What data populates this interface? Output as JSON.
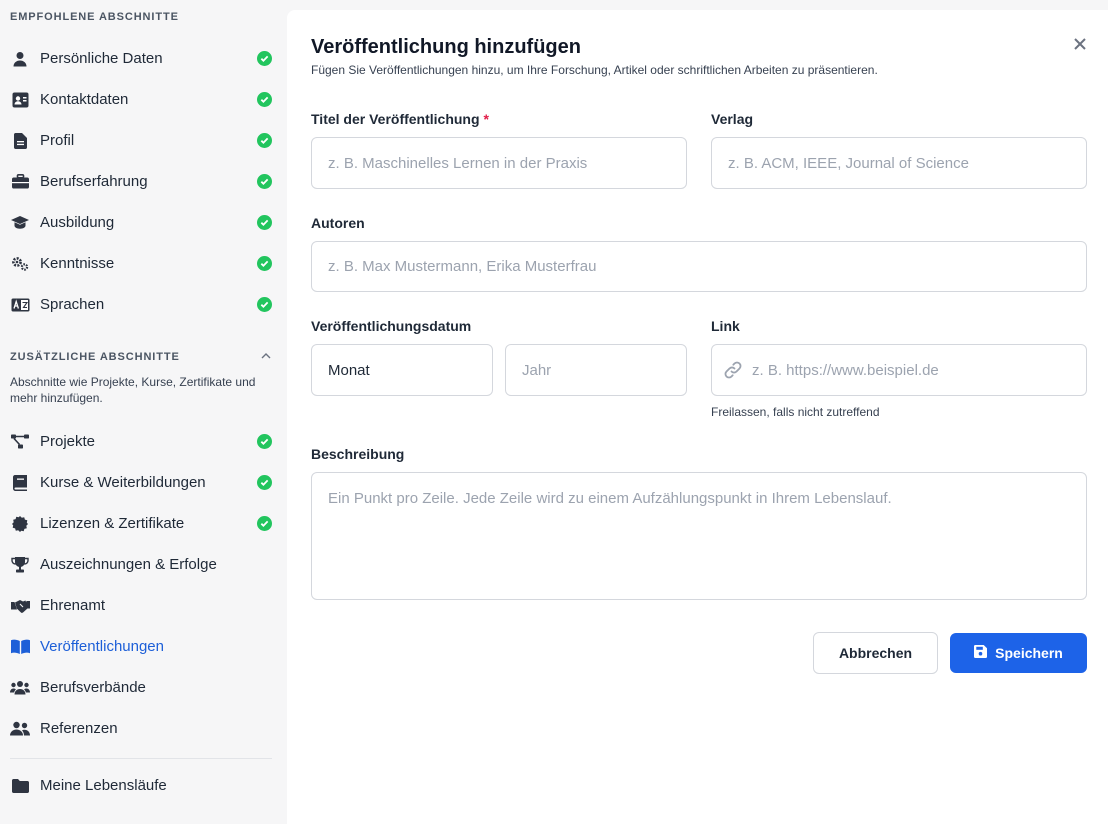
{
  "sidebar": {
    "recommended_title": "EMPFOHLENE ABSCHNITTE",
    "recommended": [
      {
        "label": "Persönliche Daten",
        "icon": "user-icon",
        "done": true
      },
      {
        "label": "Kontaktdaten",
        "icon": "contact-card-icon",
        "done": true
      },
      {
        "label": "Profil",
        "icon": "document-icon",
        "done": true
      },
      {
        "label": "Berufserfahrung",
        "icon": "briefcase-icon",
        "done": true
      },
      {
        "label": "Ausbildung",
        "icon": "graduation-cap-icon",
        "done": true
      },
      {
        "label": "Kenntnisse",
        "icon": "gears-icon",
        "done": true
      },
      {
        "label": "Sprachen",
        "icon": "language-icon",
        "done": true
      }
    ],
    "additional_title": "ZUSÄTZLICHE ABSCHNITTE",
    "additional_note": "Abschnitte wie Projekte, Kurse, Zertifikate und mehr hinzufügen.",
    "additional": [
      {
        "label": "Projekte",
        "icon": "project-diagram-icon",
        "done": true
      },
      {
        "label": "Kurse & Weiterbildungen",
        "icon": "book-icon",
        "done": true
      },
      {
        "label": "Lizenzen & Zertifikate",
        "icon": "certificate-icon",
        "done": true
      },
      {
        "label": "Auszeichnungen & Erfolge",
        "icon": "trophy-icon",
        "done": false
      },
      {
        "label": "Ehrenamt",
        "icon": "handshake-icon",
        "done": false
      },
      {
        "label": "Veröffentlichungen",
        "icon": "open-book-icon",
        "done": false,
        "active": true
      },
      {
        "label": "Berufsverbände",
        "icon": "users-icon",
        "done": false
      },
      {
        "label": "Referenzen",
        "icon": "user-friends-icon",
        "done": false
      }
    ],
    "footer_item": {
      "label": "Meine Lebensläufe",
      "icon": "folder-icon"
    }
  },
  "dialog": {
    "title": "Veröffentlichung hinzufügen",
    "subtitle": "Fügen Sie Veröffentlichungen hinzu, um Ihre Forschung, Artikel oder schriftlichen Arbeiten zu präsentieren.",
    "fields": {
      "title_label": "Titel der Veröffentlichung",
      "required_mark": "*",
      "title_placeholder": "z. B. Maschinelles Lernen in der Praxis",
      "title_value": "",
      "publisher_label": "Verlag",
      "publisher_placeholder": "z. B. ACM, IEEE, Journal of Science",
      "publisher_value": "",
      "authors_label": "Autoren",
      "authors_placeholder": "z. B. Max Mustermann, Erika Musterfrau",
      "authors_value": "",
      "date_label": "Veröffentlichungsdatum",
      "month_value": "Monat",
      "year_placeholder": "Jahr",
      "year_value": "",
      "link_label": "Link",
      "link_placeholder": "z. B. https://www.beispiel.de",
      "link_value": "",
      "link_hint": "Freilassen, falls nicht zutreffend",
      "description_label": "Beschreibung",
      "description_placeholder": "Ein Punkt pro Zeile. Jede Zeile wird zu einem Aufzählungspunkt in Ihrem Lebenslauf.",
      "description_value": ""
    },
    "cancel_label": "Abbrechen",
    "save_label": "Speichern"
  },
  "colors": {
    "accent": "#1d63e8",
    "active_nav": "#1d5fd8",
    "check": "#22c55e",
    "required": "#e11d48"
  }
}
